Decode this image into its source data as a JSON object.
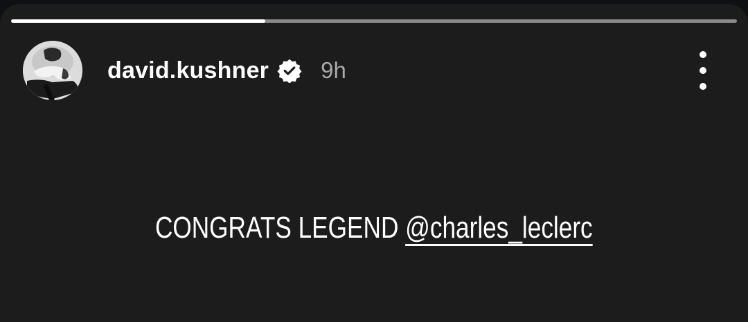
{
  "story": {
    "progress": 0.35,
    "author": {
      "username": "david.kushner",
      "verified": true,
      "posted_ago": "9h"
    },
    "menu_icon": "more-vertical-icon",
    "caption": {
      "text": "CONGRATS LEGEND ",
      "mention": "@charles_leclerc"
    }
  },
  "colors": {
    "background": "#1c1c1c",
    "text": "#ffffff",
    "muted_text": "#a9a9a9",
    "progress_track": "#8a8a8a",
    "progress_fill": "#ffffff"
  }
}
